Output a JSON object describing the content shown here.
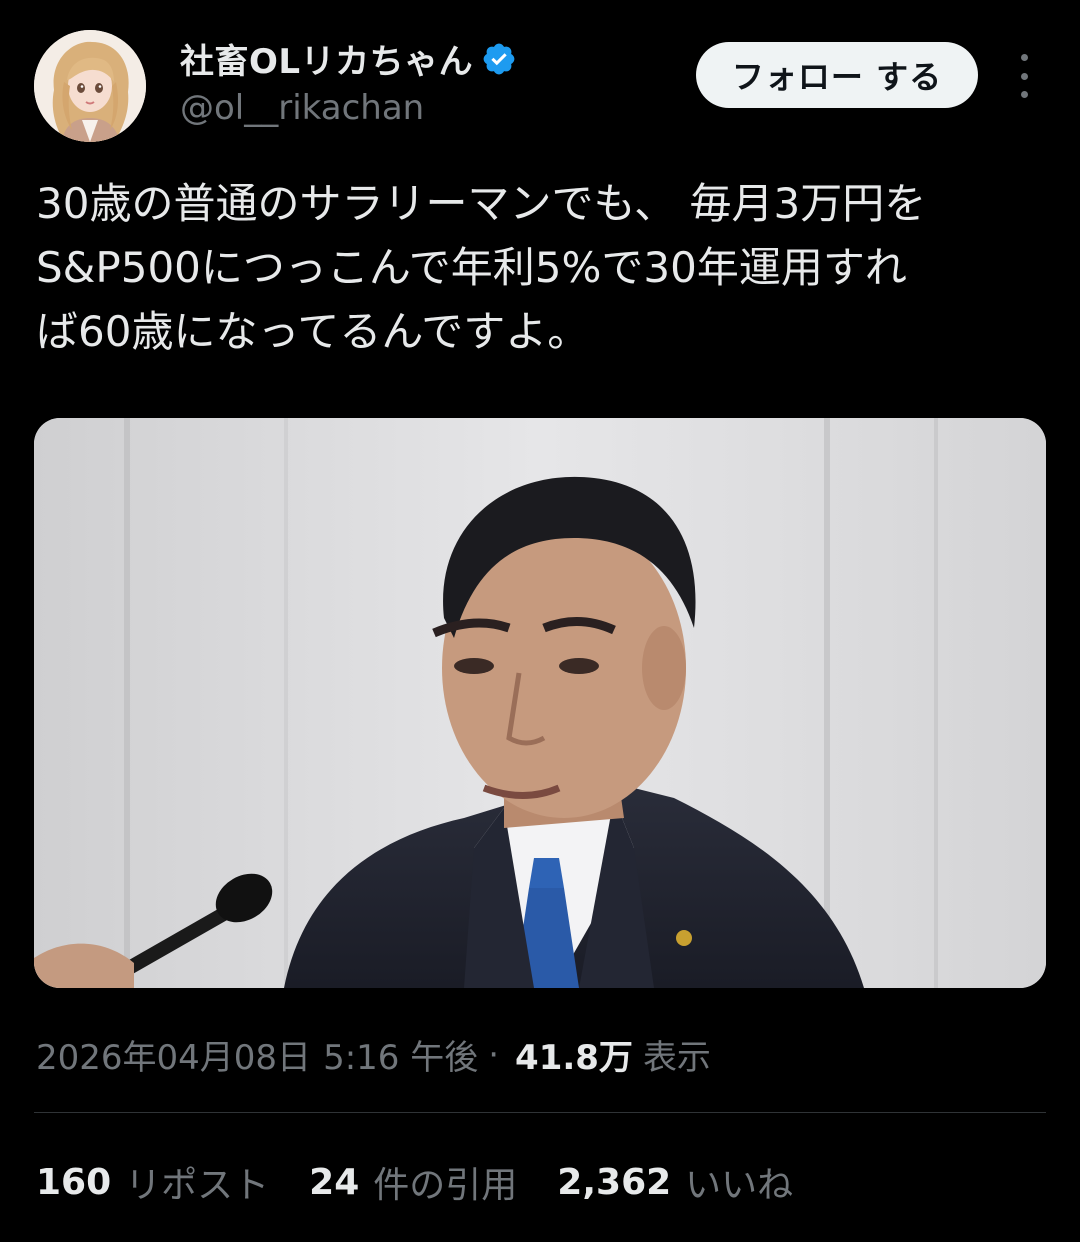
{
  "author": {
    "display_name": "社畜OLリカちゃん",
    "handle": "@ol__rikachan",
    "verified_icon": "verified-badge-icon",
    "verified_color": "#1d9bf0"
  },
  "actions": {
    "follow_label": "フォロー する",
    "more_icon": "more-vertical-icon"
  },
  "tweet": {
    "text": "30歳の普通のサラリーマンでも、 毎月3万円を\nS&P500につっこんで年利5%で30年運用すれ\nば60歳になってるんですよ。",
    "media_description_icon": "photo-speaker-at-microphone"
  },
  "meta": {
    "date": "2026年04月08日",
    "time": "5:16 午後",
    "separator": "·",
    "views": "41.8万",
    "views_label": "表示"
  },
  "stats": [
    {
      "number": "160",
      "label": "リポスト"
    },
    {
      "number": "24",
      "label": "件の引用"
    },
    {
      "number": "2,362",
      "label": "いいね"
    }
  ],
  "colors": {
    "background": "#000000",
    "text_primary": "#e7e9ea",
    "text_secondary": "#71767b",
    "follow_button_bg": "#eff3f4",
    "divider": "#2f3336"
  }
}
